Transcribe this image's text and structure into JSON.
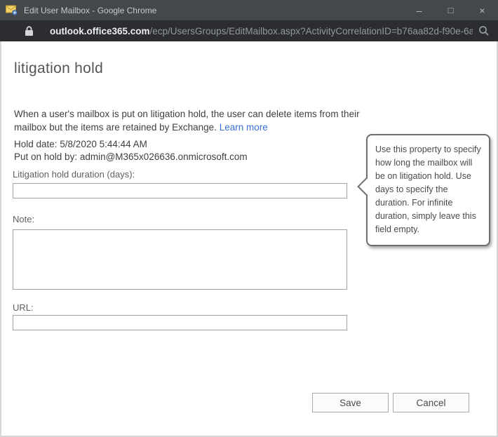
{
  "window": {
    "title": "Edit User Mailbox - Google Chrome",
    "controls": {
      "minimize": "–",
      "maximize": "□",
      "close": "×"
    }
  },
  "urlbar": {
    "domain": "outlook.office365.com",
    "path": "/ecp/UsersGroups/EditMailbox.aspx?ActivityCorrelationID=b76aa82d-f90e-6a5..."
  },
  "icons": {
    "app_icon": "mailbox-settings-envelope",
    "lock_icon": "secure-padlock",
    "zoom_icon": "page-zoom-magnifier"
  },
  "page": {
    "heading": "litigation hold",
    "description": "When a user's mailbox is put on litigation hold, the user can delete items from their mailbox but the items are retained by Exchange.",
    "learn_more": "Learn more",
    "hold_date": "Hold date: 5/8/2020 5:44:44 AM",
    "put_on_hold_by": "Put on hold by: admin@M365x026636.onmicrosoft.com",
    "fields": {
      "duration": {
        "label": "Litigation hold duration (days):",
        "value": ""
      },
      "note": {
        "label": "Note:",
        "value": ""
      },
      "url": {
        "label": "URL:",
        "value": ""
      }
    },
    "tooltip": "Use this property to specify how long the mailbox will be on litigation hold. Use days to specify the duration. For infinite duration, simply leave this field empty.",
    "buttons": {
      "save": "Save",
      "cancel": "Cancel"
    }
  },
  "colors": {
    "titlebar_bg": "#45484b",
    "urlbar_bg": "#2b2d30",
    "link": "#3b6fd6",
    "tooltip_border": "#6e6e6e",
    "input_border": "#a3a3a3"
  }
}
